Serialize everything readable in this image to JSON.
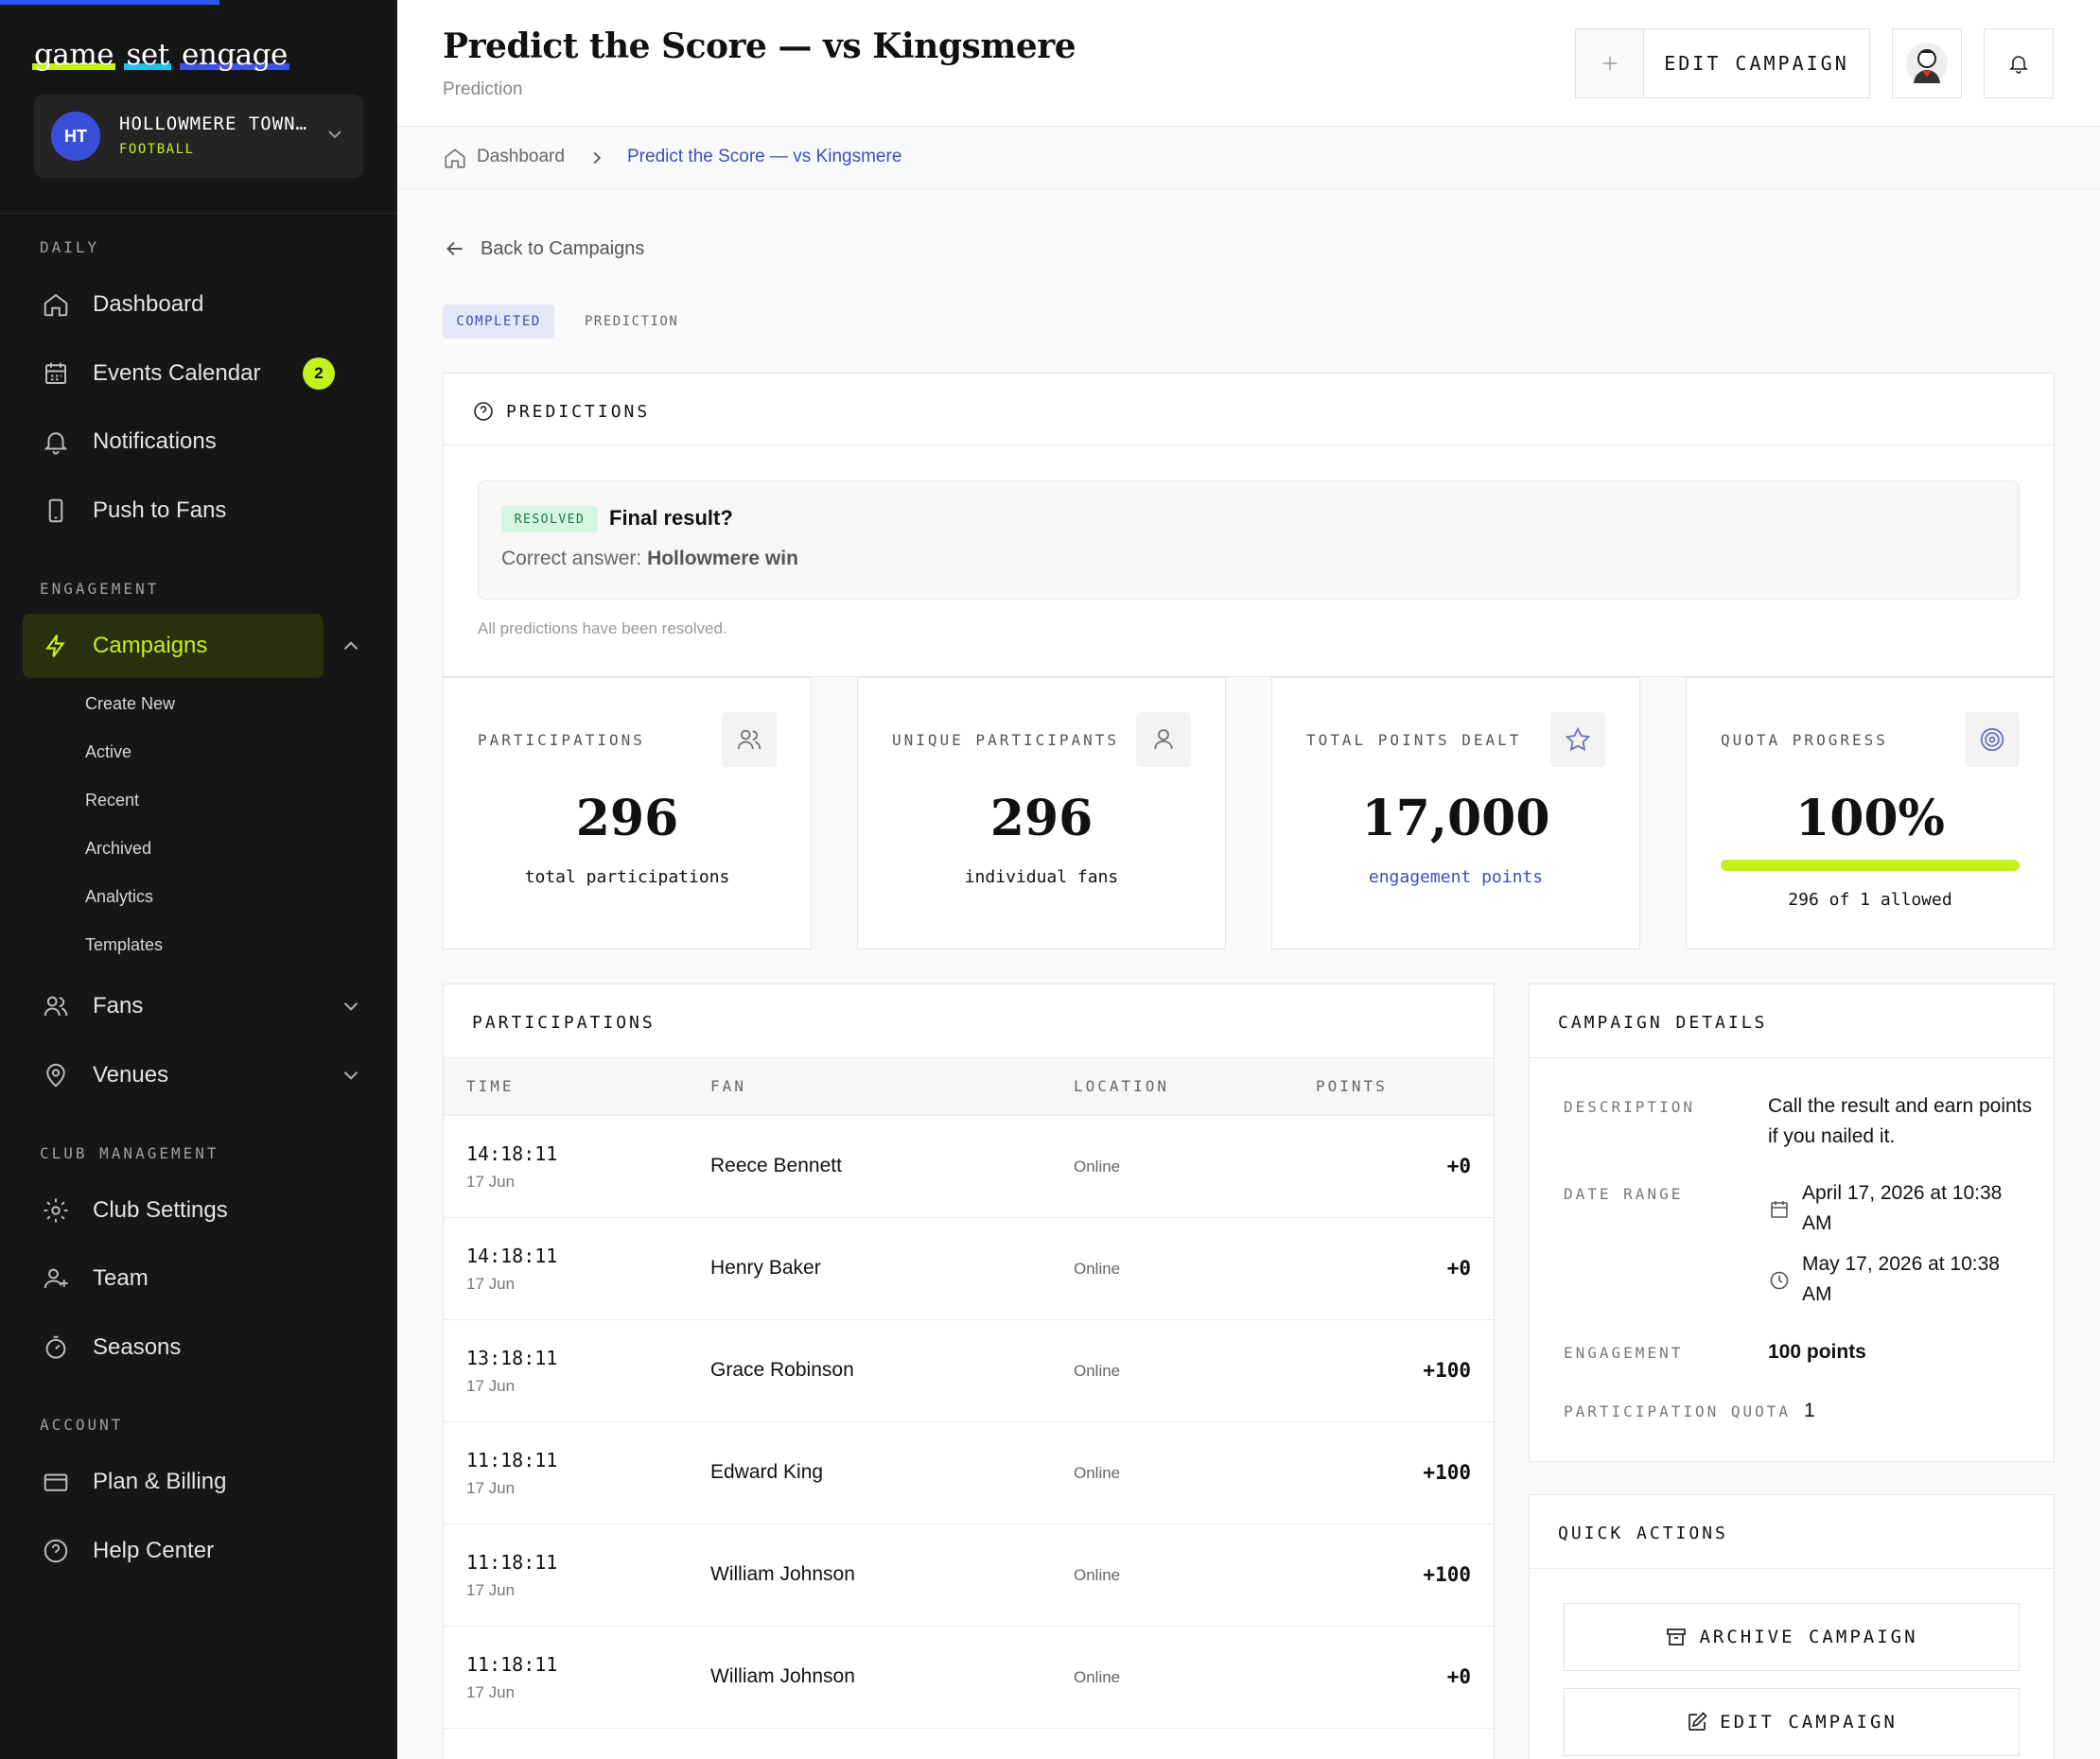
{
  "brand": {
    "logo_words": [
      "game",
      "set",
      "engage"
    ],
    "accent": "#c4f01c",
    "primary": "#3c4fb8",
    "sidebar_bg": "#161616"
  },
  "club": {
    "initials": "HT",
    "name": "HOLLOWMERE TOWN…",
    "sport": "FOOTBALL"
  },
  "sidebar": {
    "sections": {
      "daily": "DAILY",
      "engagement": "ENGAGEMENT",
      "club_management": "CLUB MANAGEMENT",
      "account": "ACCOUNT"
    },
    "items": {
      "dashboard": "Dashboard",
      "events_calendar": "Events Calendar",
      "events_badge": "2",
      "notifications": "Notifications",
      "push_to_fans": "Push to Fans",
      "campaigns": "Campaigns",
      "fans": "Fans",
      "venues": "Venues",
      "club_settings": "Club Settings",
      "team": "Team",
      "seasons": "Seasons",
      "plan_billing": "Plan & Billing",
      "help_center": "Help Center"
    },
    "campaigns_sub": [
      "Create New",
      "Active",
      "Recent",
      "Archived",
      "Analytics",
      "Templates"
    ]
  },
  "header": {
    "title": "Predict the Score — vs Kingsmere",
    "subtitle": "Prediction",
    "edit_label": "EDIT CAMPAIGN"
  },
  "breadcrumb": {
    "root": "Dashboard",
    "current": "Predict the Score — vs Kingsmere"
  },
  "back_label": "Back to Campaigns",
  "status": {
    "state": "COMPLETED",
    "type": "PREDICTION"
  },
  "predictions": {
    "heading": "PREDICTIONS",
    "badge": "RESOLVED",
    "question": "Final result?",
    "answer_prefix": "Correct answer:",
    "answer": "Hollowmere win",
    "note": "All predictions have been resolved."
  },
  "stats": {
    "participations": {
      "label": "PARTICIPATIONS",
      "value": "296",
      "caption": "total participations"
    },
    "unique": {
      "label": "UNIQUE PARTICIPANTS",
      "value": "296",
      "caption": "individual fans"
    },
    "points": {
      "label": "TOTAL POINTS DEALT",
      "value": "17,000",
      "caption": "engagement points"
    },
    "quota": {
      "label": "QUOTA PROGRESS",
      "value": "100%",
      "caption": "296 of 1 allowed",
      "fill_percent": 100
    }
  },
  "participations": {
    "heading": "PARTICIPATIONS",
    "columns": [
      "TIME",
      "FAN",
      "LOCATION",
      "POINTS"
    ],
    "rows": [
      {
        "time": "14:18:11",
        "date": "17 Jun",
        "fan": "Reece Bennett",
        "location": "Online",
        "points": "+0"
      },
      {
        "time": "14:18:11",
        "date": "17 Jun",
        "fan": "Henry Baker",
        "location": "Online",
        "points": "+0"
      },
      {
        "time": "13:18:11",
        "date": "17 Jun",
        "fan": "Grace Robinson",
        "location": "Online",
        "points": "+100"
      },
      {
        "time": "11:18:11",
        "date": "17 Jun",
        "fan": "Edward King",
        "location": "Online",
        "points": "+100"
      },
      {
        "time": "11:18:11",
        "date": "17 Jun",
        "fan": "William Johnson",
        "location": "Online",
        "points": "+100"
      },
      {
        "time": "11:18:11",
        "date": "17 Jun",
        "fan": "William Johnson",
        "location": "Online",
        "points": "+0"
      }
    ]
  },
  "details": {
    "heading": "CAMPAIGN DETAILS",
    "description_label": "DESCRIPTION",
    "description": "Call the result and earn points if you nailed it.",
    "date_range_label": "DATE RANGE",
    "start": "April 17, 2026 at 10:38 AM",
    "end": "May 17, 2026 at 10:38 AM",
    "engagement_label": "ENGAGEMENT",
    "engagement": "100 points",
    "quota_label": "PARTICIPATION QUOTA",
    "quota": "1"
  },
  "quick_actions": {
    "heading": "QUICK ACTIONS",
    "archive": "ARCHIVE CAMPAIGN",
    "edit": "EDIT CAMPAIGN"
  }
}
